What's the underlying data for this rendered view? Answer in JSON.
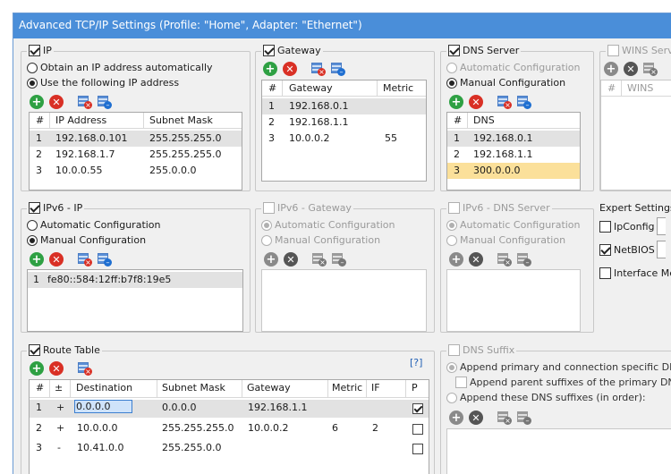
{
  "window": {
    "title": "Advanced TCP/IP Settings (Profile: \"Home\", Adapter: \"Ethernet\")"
  },
  "ip": {
    "title": "IP",
    "auto_label": "Obtain an IP address automatically",
    "manual_label": "Use the following IP address",
    "columns": [
      "#",
      "IP Address",
      "Subnet Mask"
    ],
    "rows": [
      [
        "1",
        "192.168.0.101",
        "255.255.255.0"
      ],
      [
        "2",
        "192.168.1.7",
        "255.255.255.0"
      ],
      [
        "3",
        "10.0.0.55",
        "255.0.0.0"
      ]
    ]
  },
  "gateway": {
    "title": "Gateway",
    "columns": [
      "#",
      "Gateway",
      "Metric"
    ],
    "rows": [
      [
        "1",
        "192.168.0.1",
        ""
      ],
      [
        "2",
        "192.168.1.1",
        ""
      ],
      [
        "3",
        "10.0.0.2",
        "55"
      ]
    ]
  },
  "dns": {
    "title": "DNS Server",
    "auto_label": "Automatic Configuration",
    "manual_label": "Manual Configuration",
    "columns": [
      "#",
      "DNS"
    ],
    "rows": [
      [
        "1",
        "192.168.0.1"
      ],
      [
        "2",
        "192.168.1.1"
      ],
      [
        "3",
        "300.0.0.0"
      ]
    ]
  },
  "wins": {
    "title": "WINS Server",
    "columns": [
      "#",
      "WINS"
    ]
  },
  "expert": {
    "title": "Expert Settings",
    "ipconfig_label": "IpConfig",
    "netbios_label": "NetBIOS",
    "interface_label": "Interface Metric"
  },
  "ipv6_ip": {
    "title": "IPv6 - IP",
    "auto_label": "Automatic Configuration",
    "manual_label": "Manual Configuration",
    "rows": [
      [
        "1",
        "fe80::584:12ff:b7f8:19e5"
      ]
    ]
  },
  "ipv6_gateway": {
    "title": "IPv6 - Gateway",
    "auto_label": "Automatic Configuration",
    "manual_label": "Manual Configuration"
  },
  "ipv6_dns": {
    "title": "IPv6 - DNS Server",
    "auto_label": "Automatic Configuration",
    "manual_label": "Manual Configuration"
  },
  "route": {
    "title": "Route Table",
    "help_label": "[?]",
    "columns": [
      "#",
      "±",
      "Destination",
      "Subnet Mask",
      "Gateway",
      "Metric",
      "IF",
      "P"
    ],
    "rows": [
      {
        "n": "1",
        "op": "+",
        "dest": "0.0.0.0",
        "mask": "0.0.0.0",
        "gw": "192.168.1.1",
        "metric": "",
        "iface": "",
        "p": true
      },
      {
        "n": "2",
        "op": "+",
        "dest": "10.0.0.0",
        "mask": "255.255.255.0",
        "gw": "10.0.0.2",
        "metric": "6",
        "iface": "2",
        "p": false
      },
      {
        "n": "3",
        "op": "-",
        "dest": "10.41.0.0",
        "mask": "255.255.0.0",
        "gw": "",
        "metric": "",
        "iface": "",
        "p": false
      }
    ]
  },
  "dns_suffix": {
    "title": "DNS Suffix",
    "append_primary_label": "Append primary and connection specific DNS suffixes",
    "append_parent_label": "Append parent suffixes of the primary DNS suffix",
    "append_these_label": "Append these DNS suffixes (in order):"
  },
  "colors": {
    "titlebar": "#4a8ed9",
    "selected_row": "#e2e2e2",
    "invalid_row": "#fbe09a"
  }
}
